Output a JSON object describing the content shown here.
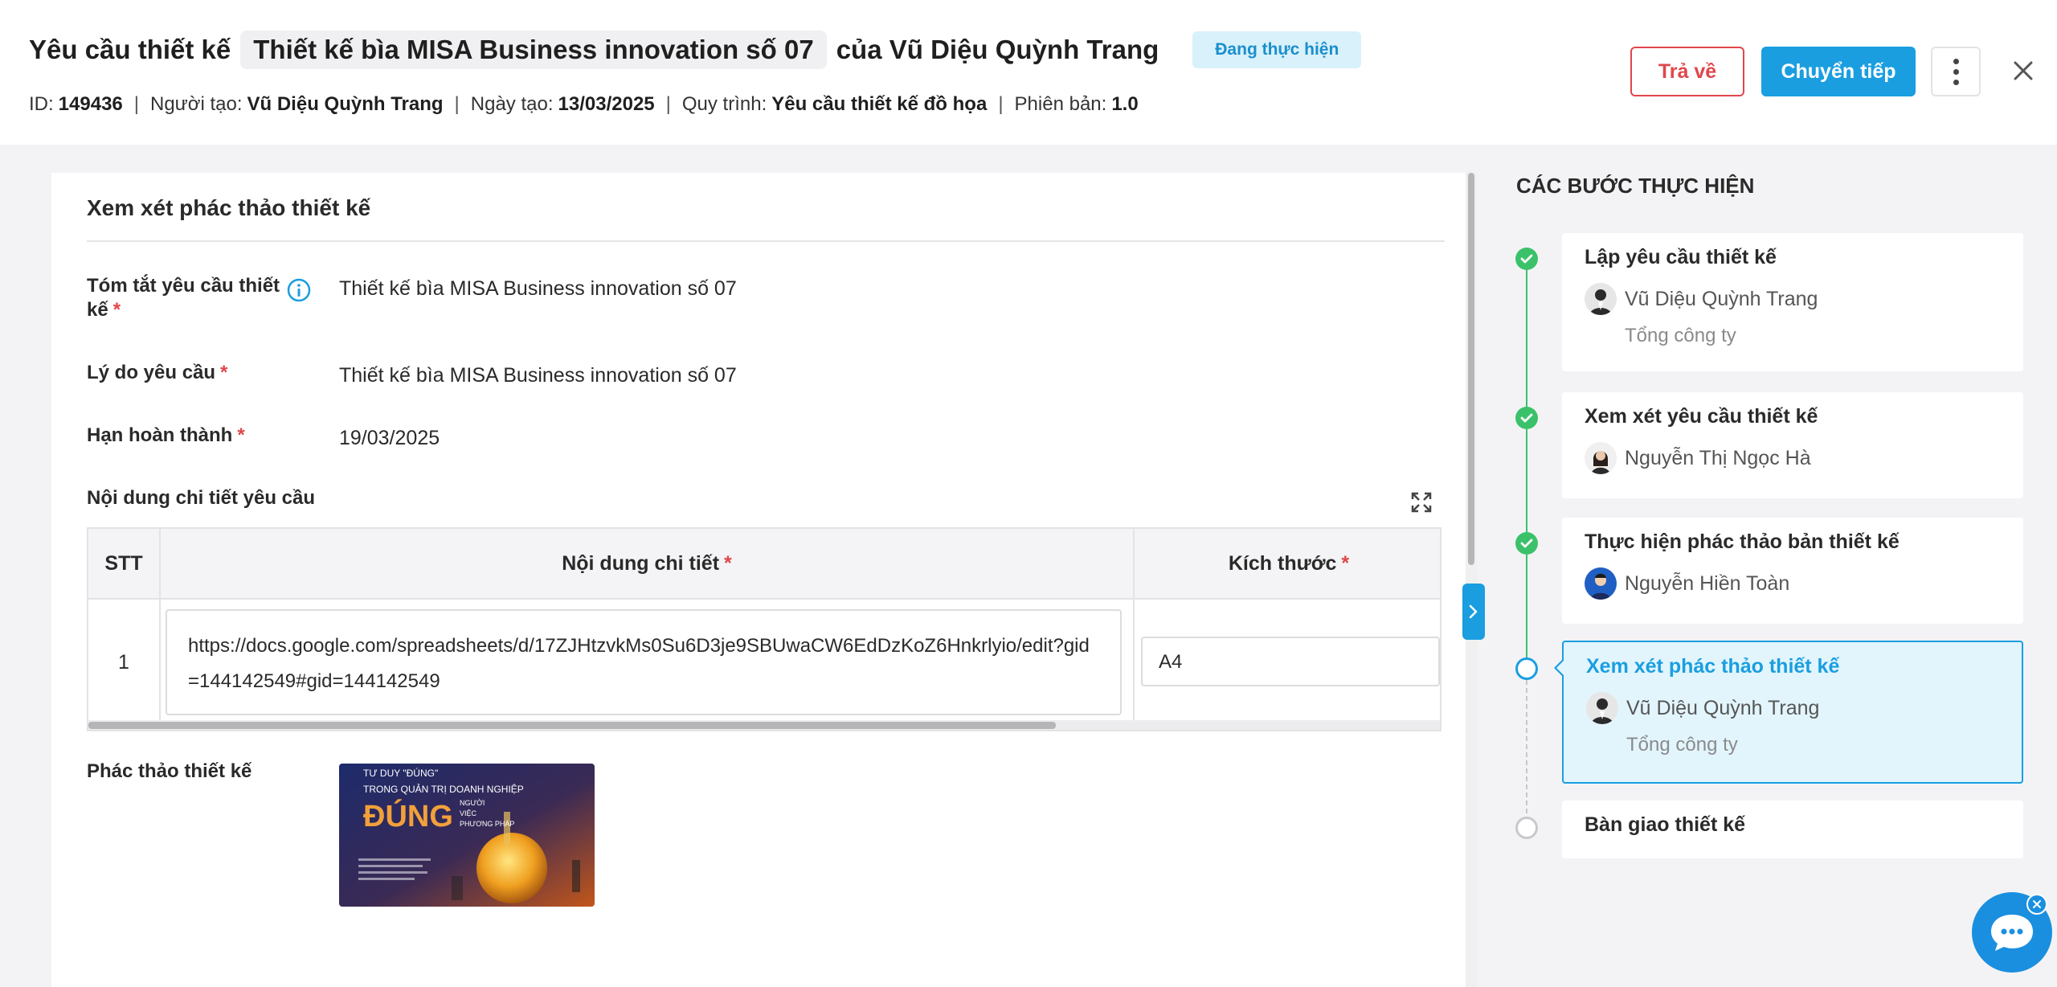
{
  "header": {
    "title_prefix": "Yêu cầu thiết kế",
    "title_chip": "Thiết kế bìa MISA Business innovation số 07",
    "title_suffix": "của Vũ Diệu Quỳnh Trang",
    "status": "Đang thực hiện",
    "meta": {
      "id_label": "ID:",
      "id_value": "149436",
      "creator_label": "Người tạo:",
      "creator_value": "Vũ Diệu Quỳnh Trang",
      "created_label": "Ngày tạo:",
      "created_value": "13/03/2025",
      "process_label": "Quy trình:",
      "process_value": "Yêu cầu thiết kế đồ họa",
      "version_label": "Phiên bản:",
      "version_value": "1.0",
      "separator": "|"
    },
    "return_label": "Trả về",
    "forward_label": "Chuyển tiếp"
  },
  "form": {
    "section_title": "Xem xét phác thảo thiết kế",
    "summary_label_line1": "Tóm tắt yêu cầu thiết",
    "summary_label_line2": "kế",
    "summary_value": "Thiết kế bìa MISA Business innovation số 07",
    "reason_label": "Lý do yêu cầu",
    "reason_value": "Thiết kế bìa MISA Business innovation số 07",
    "deadline_label": "Hạn hoàn thành",
    "deadline_value": "19/03/2025",
    "detail_label": "Nội dung chi tiết yêu cầu",
    "required_mark": "*",
    "draft_label": "Phác thảo thiết kế"
  },
  "table": {
    "columns": [
      "STT",
      "Nội dung chi tiết",
      "Kích thước"
    ],
    "rows": [
      {
        "stt": "1",
        "content": "https://docs.google.com/spreadsheets/d/17ZJHtzvkMs0Su6D3je9SBUwaCW6EdDzKoZ6Hnkrlyio/edit?gid=144142549#gid=144142549",
        "size": "A4"
      }
    ]
  },
  "thumbnail": {
    "line1": "TƯ DUY \"ĐÚNG\"",
    "line2": "TRONG QUẢN TRỊ DOANH NGHIỆP",
    "big": "ĐÚNG",
    "side1": "NGƯỜI",
    "side2": "VIỆC",
    "side3": "PHƯƠNG PHÁP"
  },
  "steps": {
    "title": "CÁC BƯỚC THỰC HIỆN",
    "items": [
      {
        "name": "Lập yêu cầu thiết kế",
        "user": "Vũ Diệu Quỳnh Trang",
        "org": "Tổng công ty",
        "state": "done"
      },
      {
        "name": "Xem xét yêu cầu thiết kế",
        "user": "Nguyễn Thị Ngọc Hà",
        "org": "",
        "state": "done"
      },
      {
        "name": "Thực hiện phác thảo bản thiết kế",
        "user": "Nguyễn Hiền Toàn",
        "org": "",
        "state": "done"
      },
      {
        "name": "Xem xét phác thảo thiết kế",
        "user": "Vũ Diệu Quỳnh Trang",
        "org": "Tổng công ty",
        "state": "current"
      },
      {
        "name": "Bàn giao thiết kế",
        "user": "",
        "org": "",
        "state": "pending"
      }
    ]
  },
  "colors": {
    "primary": "#1a9ee0",
    "danger": "#e0464b",
    "success": "#3cc16b",
    "status_bg": "#d9f1fb"
  },
  "icons": [
    "info-icon",
    "expand-icon",
    "more-vertical-icon",
    "close-icon",
    "chevron-right-icon",
    "check-icon",
    "chat-icon"
  ]
}
